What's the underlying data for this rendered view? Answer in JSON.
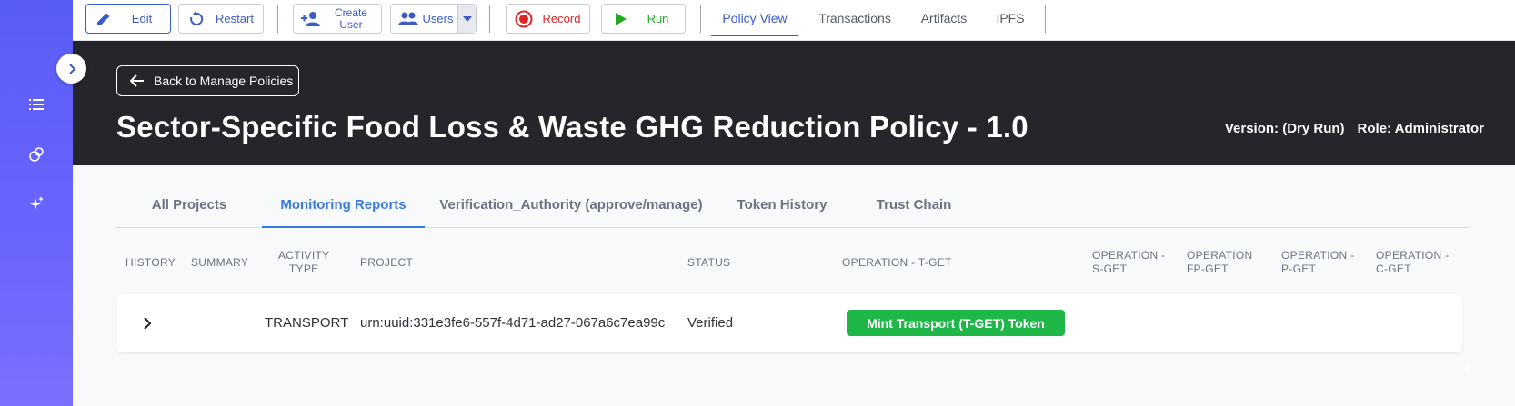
{
  "toolbar": {
    "edit_label": "Edit",
    "restart_label": "Restart",
    "create_user_label_1": "Create",
    "create_user_label_2": "User",
    "users_label": "Users",
    "record_label": "Record",
    "run_label": "Run",
    "tabs": [
      "Policy View",
      "Transactions",
      "Artifacts",
      "IPFS"
    ]
  },
  "header": {
    "back_label": "Back to Manage Policies",
    "title": "Sector-Specific Food Loss & Waste GHG Reduction Policy - 1.0",
    "version": "Version: (Dry Run)",
    "role": "Role: Administrator"
  },
  "subtabs": [
    "All Projects",
    "Monitoring Reports",
    "Verification_Authority (approve/manage)",
    "Token History",
    "Trust Chain"
  ],
  "table": {
    "headers": {
      "history": "HISTORY",
      "summary": "SUMMARY",
      "activity_1": "ACTIVITY",
      "activity_2": "TYPE",
      "project": "PROJECT",
      "status": "STATUS",
      "op_tget": "OPERATION - T-GET",
      "op_sget_1": "OPERATION -",
      "op_sget_2": "S-GET",
      "op_fpget_1": "OPERATION",
      "op_fpget_2": "FP-GET",
      "op_pget_1": "OPERATION -",
      "op_pget_2": "P-GET",
      "op_cget_1": "OPERATION -",
      "op_cget_2": "C-GET"
    },
    "rows": [
      {
        "activity_type": "TRANSPORT",
        "project": "urn:uuid:331e3fe6-557f-4d71-ad27-067a6c7ea99c",
        "status": "Verified",
        "action": "Mint Transport (T-GET) Token"
      }
    ]
  },
  "colors": {
    "rail": "#5a5cf6",
    "accent": "#3a5cc8",
    "band": "#24262c",
    "record": "#e02424",
    "run": "#1faa1f",
    "mint_button": "#1fb848"
  },
  "icons": [
    "list-icon",
    "circles-icon",
    "sparkle-icon",
    "chevron-right-icon",
    "pencil-icon",
    "restart-icon",
    "add-user-icon",
    "users-icon",
    "caret-down-icon",
    "record-icon",
    "play-icon",
    "arrow-left-icon"
  ]
}
